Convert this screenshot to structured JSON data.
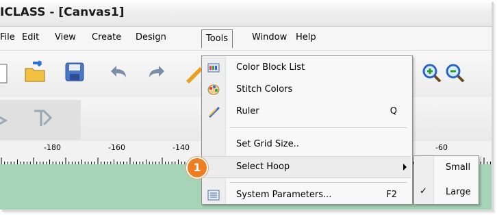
{
  "window": {
    "title": "ICLASS - [Canvas1]"
  },
  "menubar": {
    "items": [
      {
        "label": "File"
      },
      {
        "label": "Edit"
      },
      {
        "label": "View"
      },
      {
        "label": "Create"
      },
      {
        "label": "Design"
      },
      {
        "label": "Tools"
      },
      {
        "label": "Window"
      },
      {
        "label": "Help"
      }
    ],
    "active": "Tools"
  },
  "toolbar": {
    "buttons": [
      "new-document-icon",
      "open-folder-icon",
      "save-icon",
      "undo-icon",
      "redo-icon",
      "pen-icon",
      "zoom-in-icon",
      "zoom-out-icon"
    ]
  },
  "ruler": {
    "ticks": [
      "-180",
      "-160",
      "-140",
      "-60"
    ]
  },
  "tools_menu": {
    "items": [
      {
        "label": "Color Block List",
        "shortcut": "",
        "icon": "color-block-list-icon"
      },
      {
        "label": "Stitch Colors",
        "shortcut": "",
        "icon": "palette-icon"
      },
      {
        "label": "Ruler",
        "shortcut": "Q",
        "icon": "ruler-icon"
      },
      {
        "label": "Set Grid Size..",
        "shortcut": ""
      },
      {
        "label": "Select Hoop",
        "shortcut": "",
        "has_submenu": true
      },
      {
        "label": "System Parameters...",
        "shortcut": "F2",
        "icon": "parameters-icon"
      }
    ]
  },
  "hoop_submenu": {
    "items": [
      {
        "label": "Small",
        "checked": false
      },
      {
        "label": "Large",
        "checked": true
      }
    ]
  },
  "callout": {
    "number": "1",
    "color": "#ef7d22"
  }
}
